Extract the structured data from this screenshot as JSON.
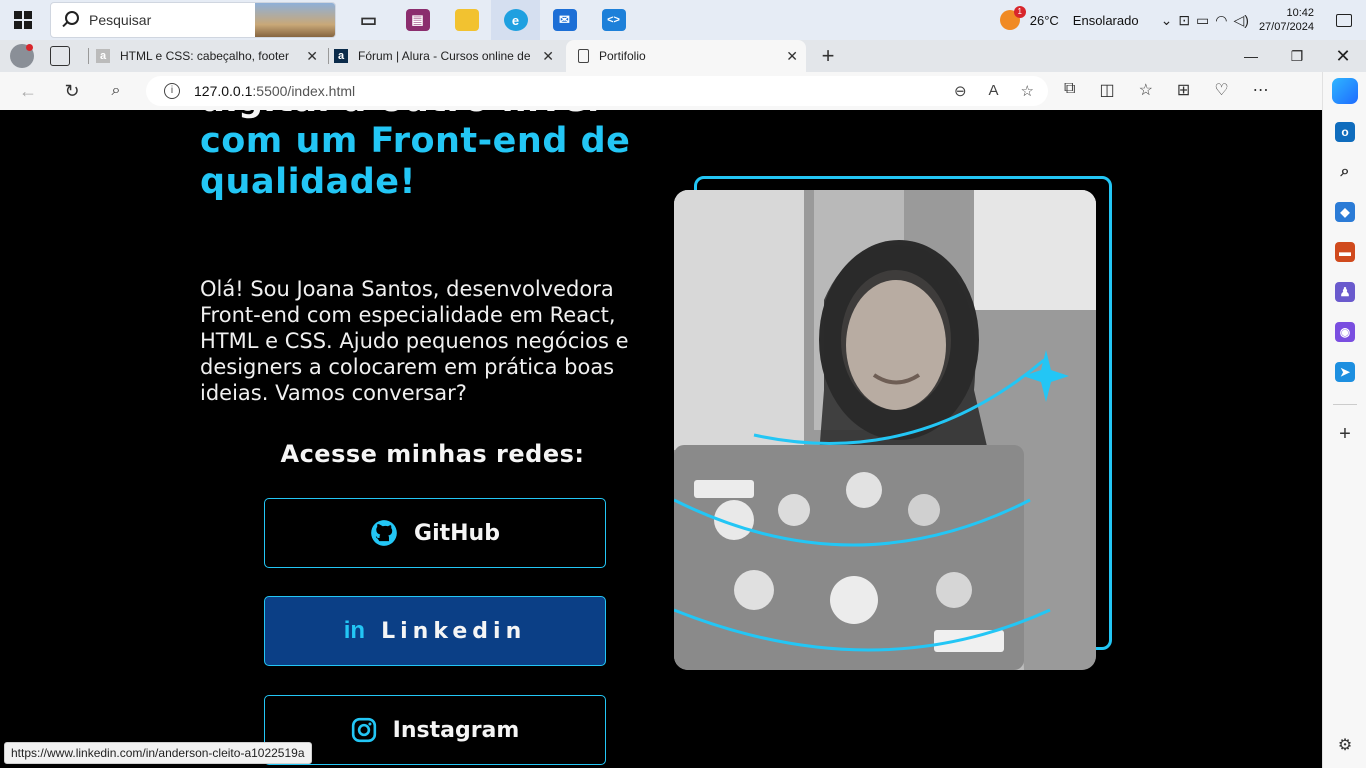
{
  "taskbar": {
    "search_placeholder": "Pesquisar",
    "apps": [
      {
        "icon": "task-view-icon",
        "color": "#444444",
        "glyph": "▭"
      },
      {
        "icon": "winrar-icon",
        "color": "#8b2d6e",
        "glyph": "▤"
      },
      {
        "icon": "file-explorer-icon",
        "color": "#f2c230",
        "glyph": "▆"
      },
      {
        "icon": "edge-icon",
        "color": "#1fa0e0",
        "glyph": "e"
      },
      {
        "icon": "mail-icon",
        "color": "#1d6fd6",
        "glyph": "✉"
      },
      {
        "icon": "vscode-icon",
        "color": "#1d80d9",
        "glyph": "❮❯"
      }
    ],
    "weather_badge": "1",
    "temperature": "26°C",
    "weather": "Ensolarado",
    "time": "10:42",
    "date": "27/07/2024"
  },
  "browser": {
    "tabs": [
      {
        "title": "HTML e CSS: cabeçalho, footer e",
        "favicon": "a"
      },
      {
        "title": "Fórum | Alura - Cursos online de",
        "favicon": "a"
      },
      {
        "title": "Portifolio",
        "favicon": ""
      }
    ],
    "url_host": "127.0.0.1",
    "url_rest": ":5500/index.html",
    "status_url": "https://www.linkedin.com/in/anderson-cleito-a1022519a"
  },
  "page": {
    "title_line1": "digital a outro nível",
    "title_line2": "com um Front-end de",
    "title_line3": "qualidade!",
    "intro": "Olá! Sou Joana Santos, desenvolvedora Front-end com especialidade em React, HTML e CSS. Ajudo pequenos negócios e designers a colocarem em prática boas ideias. Vamos conversar?",
    "social_heading": "Acesse minhas redes:",
    "social": {
      "github": "GitHub",
      "linkedin": "Linkedin",
      "instagram": "Instagram"
    },
    "accent_color": "#23c6f5",
    "hover_color": "#0b3f86"
  }
}
